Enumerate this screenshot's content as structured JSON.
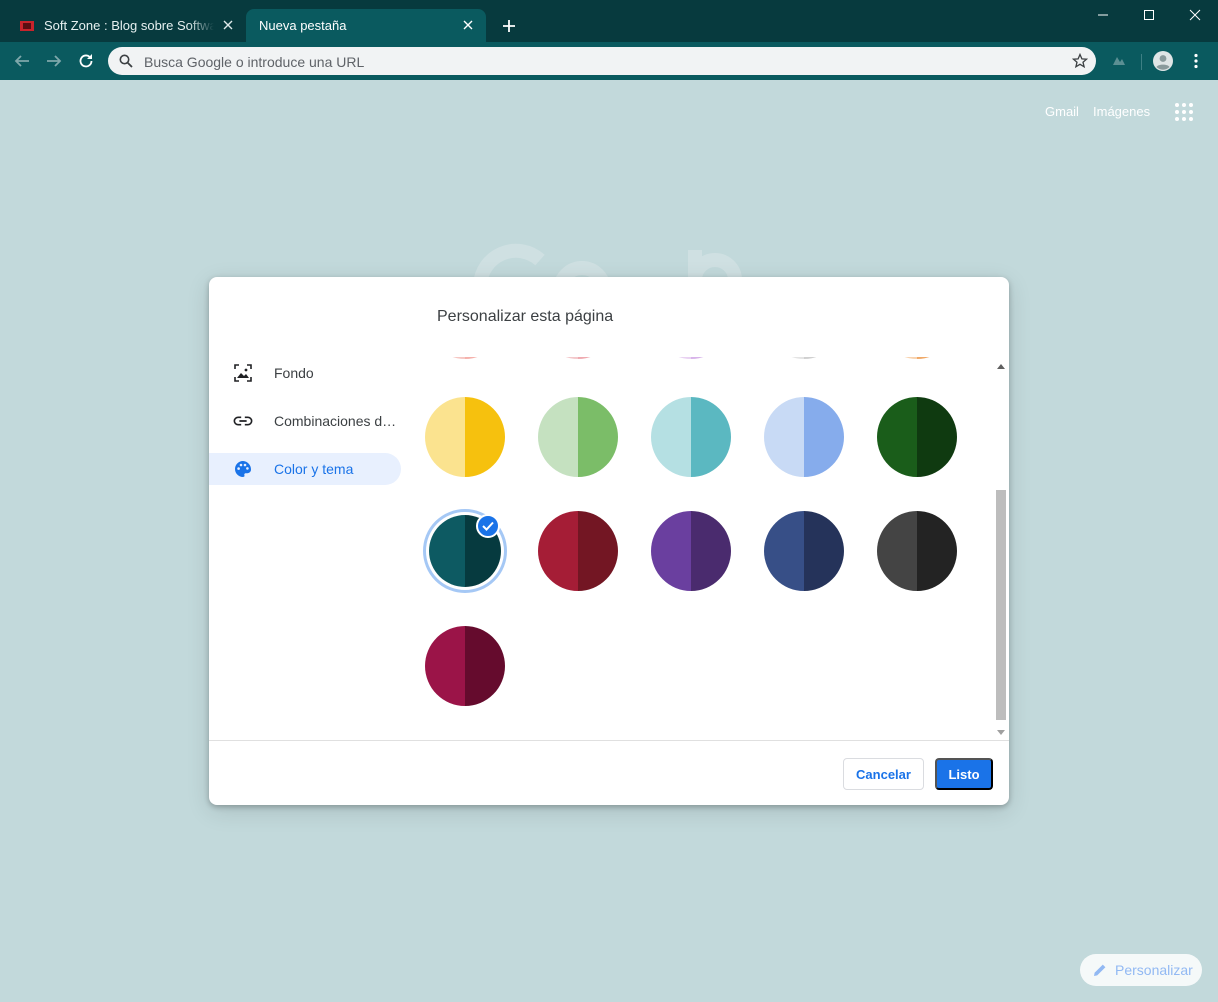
{
  "browser": {
    "tabs": [
      {
        "title": "Soft Zone : Blog sobre Software y Apps",
        "active": false
      },
      {
        "title": "Nueva pestaña",
        "active": true
      }
    ],
    "omnibox_placeholder": "Busca Google o introduce una URL"
  },
  "page": {
    "top_links": {
      "gmail": "Gmail",
      "images": "Imágenes"
    },
    "customize_label": "Personalizar"
  },
  "dialog": {
    "title": "Personalizar esta página",
    "nav": [
      {
        "label": "Fondo",
        "icon": "image-icon",
        "active": false
      },
      {
        "label": "Combinaciones de teclas",
        "icon": "link-icon",
        "active": false
      },
      {
        "label": "Color y tema",
        "icon": "palette-icon",
        "active": true
      }
    ],
    "swatches_partial_top": [
      {
        "left": "#f6c7c3",
        "right": "#f5b1ab"
      },
      {
        "left": "#f3c8cb",
        "right": "#efaab0"
      },
      {
        "left": "#e9d2f2",
        "right": "#d8b4ea"
      },
      {
        "left": "#e4e4e4",
        "right": "#d0d0d0"
      },
      {
        "left": "#f8d3b0",
        "right": "#f0a968"
      }
    ],
    "swatches": [
      {
        "left": "#fbe38f",
        "right": "#f6c10e",
        "selected": false
      },
      {
        "left": "#c5e1c0",
        "right": "#7bbd68",
        "selected": false
      },
      {
        "left": "#b5e0e3",
        "right": "#5bb8c1",
        "selected": false
      },
      {
        "left": "#c8daf5",
        "right": "#86acec",
        "selected": false
      },
      {
        "left": "#1a5d1a",
        "right": "#0f3a10",
        "selected": false
      },
      {
        "left": "#0d5a62",
        "right": "#063a3f",
        "selected": true
      },
      {
        "left": "#a51d36",
        "right": "#731623",
        "selected": false
      },
      {
        "left": "#6a3f9f",
        "right": "#4a2b6e",
        "selected": false
      },
      {
        "left": "#374f87",
        "right": "#25335a",
        "selected": false
      },
      {
        "left": "#444444",
        "right": "#232323",
        "selected": false
      },
      {
        "left": "#9b1448",
        "right": "#650b2d",
        "selected": false
      }
    ],
    "cancel_label": "Cancelar",
    "done_label": "Listo"
  },
  "colors": {
    "accent": "#1a73e8",
    "frame": "#073a3e",
    "toolbar": "#0a5a5f",
    "page_bg": "#c2d9db"
  }
}
